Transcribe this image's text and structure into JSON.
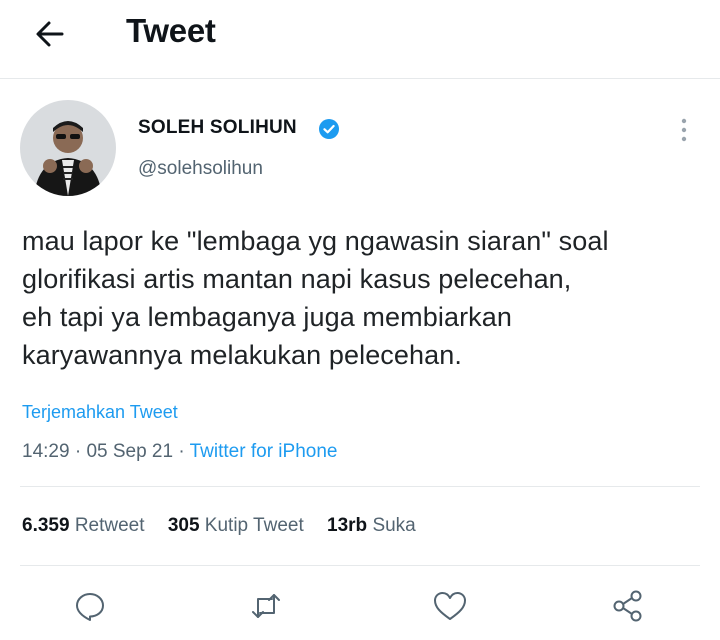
{
  "header": {
    "title": "Tweet",
    "back_icon": "arrow-left-icon"
  },
  "author": {
    "name": "SOLEH SOLIHUN",
    "handle": "@solehsolihun",
    "verified_icon": "verified-badge-icon"
  },
  "tweet": {
    "lines": [
      "mau lapor ke \"lembaga yg ngawasin siaran\" soal",
      "glorifikasi artis mantan napi kasus pelecehan,",
      "eh tapi ya lembaganya juga membiarkan",
      "karyawannya melakukan pelecehan."
    ],
    "translate_label": "Terjemahkan Tweet",
    "time": "14:29",
    "date": "05 Sep 21",
    "separator": "·",
    "source": "Twitter for iPhone"
  },
  "stats": {
    "retweets": {
      "count": "6.359",
      "label": "Retweet"
    },
    "quotes": {
      "count": "305",
      "label": "Kutip Tweet"
    },
    "likes": {
      "count": "13rb",
      "label": "Suka"
    }
  },
  "actions": [
    "reply-icon",
    "retweet-icon",
    "like-icon",
    "share-icon"
  ],
  "colors": {
    "accent": "#1d9bf0",
    "secondary_text": "#536471",
    "primary_text": "#0f1419",
    "divider": "#e6e9eb"
  }
}
